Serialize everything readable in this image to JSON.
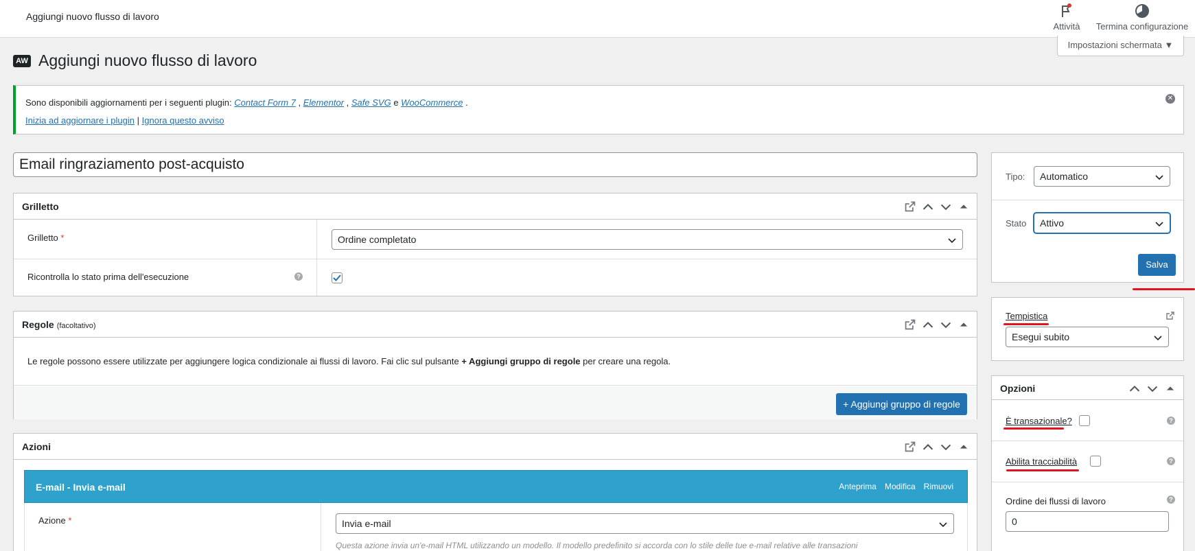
{
  "topbar": {
    "title": "Aggiungi nuovo flusso di lavoro",
    "activity_label": "Attività",
    "finish_setup_label": "Termina configurazione"
  },
  "screen_options": {
    "label": "Impostazioni schermata ▼"
  },
  "page": {
    "badge": "AW",
    "title": "Aggiungi nuovo flusso di lavoro"
  },
  "notice": {
    "text_prefix": "Sono disponibili aggiornamenti per i seguenti plugin:",
    "plugins": [
      "Contact Form 7",
      "Elementor",
      "Safe SVG",
      "WooCommerce"
    ],
    "sep1": ",",
    "sep2": ",",
    "sep3": "e",
    "end": ".",
    "update_link": "Inizia ad aggiornare i plugin",
    "divider": "|",
    "ignore_link": "Ignora questo avviso"
  },
  "workflow_title": "Email ringraziamento post-acquisto",
  "trigger_box": {
    "title": "Grilletto",
    "trigger_label": "Grilletto",
    "required_mark": "*",
    "trigger_value": "Ordine completato",
    "recheck_label": "Ricontrolla lo stato prima dell'esecuzione",
    "recheck_checked": true
  },
  "rules_box": {
    "title": "Regole",
    "title_suffix": "(facoltativo)",
    "desc_before": "Le regole possono essere utilizzate per aggiungere logica condizionale ai flussi di lavoro. Fai clic sul pulsante",
    "desc_bold": "+ Aggiungi gruppo di regole",
    "desc_after": "per creare una regola.",
    "add_button": "+ Aggiungi gruppo di regole"
  },
  "actions_box": {
    "title": "Azioni",
    "email_header": "E-mail - Invia e-mail",
    "preview_link": "Anteprima",
    "edit_link": "Modifica",
    "remove_link": "Rimuovi",
    "action_label": "Azione",
    "required_mark": "*",
    "action_value": "Invia e-mail",
    "action_desc": "Questa azione invia un'e-mail HTML utilizzando un modello. Il modello predefinito si accorda con lo stile delle tue e-mail relative alle transazioni"
  },
  "publish_box": {
    "type_label": "Tipo:",
    "type_value": "Automatico",
    "status_label": "Stato",
    "status_value": "Attivo",
    "save_button": "Salva"
  },
  "timing_box": {
    "title": "Tempistica",
    "value": "Esegui subito"
  },
  "options_box": {
    "title": "Opzioni",
    "transactional_label": "È transazionale?",
    "tracking_label": "Abilita tracciabilità",
    "order_label": "Ordine dei flussi di lavoro",
    "order_value": "0"
  },
  "colors": {
    "primary": "#2271b1",
    "notice_success": "#00a32a",
    "email_header": "#2ea2cc",
    "annotation_red": "#e0141e"
  }
}
